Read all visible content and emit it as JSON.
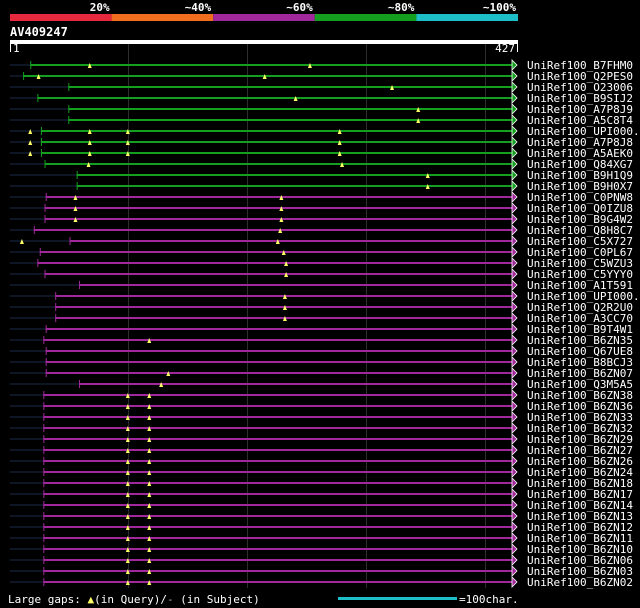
{
  "chart_data": {
    "type": "alignment-overview",
    "query_name": "AV409247",
    "query_start": "1",
    "query_end": "427",
    "query_length": 427,
    "color_legend": [
      {
        "label": "20%",
        "color": "#e8283c"
      },
      {
        "label": "~40%",
        "color": "#f06e1e"
      },
      {
        "label": "~60%",
        "color": "#a0289b"
      },
      {
        "label": "~80%",
        "color": "#14a01e"
      },
      {
        "label": "~100%",
        "color": "#1ebec8"
      }
    ],
    "hits": [
      {
        "name": "UniRef100_B7FHM0",
        "color": "#14a01e",
        "start": 18,
        "end": 427,
        "triangles": [
          68,
          253
        ]
      },
      {
        "name": "UniRef100_Q2PES0",
        "color": "#14a01e",
        "start": 12,
        "end": 427,
        "triangles": [
          25,
          215
        ]
      },
      {
        "name": "UniRef100_O23006",
        "color": "#14a01e",
        "start": 50,
        "end": 427,
        "triangles": [
          322
        ]
      },
      {
        "name": "UniRef100_B9SIJ2",
        "color": "#14a01e",
        "start": 24,
        "end": 427,
        "triangles": [
          241
        ]
      },
      {
        "name": "UniRef100_A7P8J9",
        "color": "#14a01e",
        "start": 50,
        "end": 427,
        "triangles": [
          344
        ]
      },
      {
        "name": "UniRef100_A5C8T4",
        "color": "#14a01e",
        "start": 50,
        "end": 427,
        "triangles": [
          344
        ]
      },
      {
        "name": "UniRef100_UPI000..",
        "color": "#14a01e",
        "start": 27,
        "end": 427,
        "triangles": [
          18,
          68,
          100,
          278
        ]
      },
      {
        "name": "UniRef100_A7P8J8",
        "color": "#14a01e",
        "start": 27,
        "end": 427,
        "triangles": [
          18,
          68,
          100,
          278
        ]
      },
      {
        "name": "UniRef100_A5AEK0",
        "color": "#14a01e",
        "start": 27,
        "end": 427,
        "triangles": [
          18,
          68,
          100,
          278
        ]
      },
      {
        "name": "UniRef100_Q84XG7",
        "color": "#14a01e",
        "start": 30,
        "end": 427,
        "triangles": [
          67,
          280
        ]
      },
      {
        "name": "UniRef100_B9H1Q9",
        "color": "#14a01e",
        "start": 57,
        "end": 427,
        "triangles": [
          352
        ]
      },
      {
        "name": "UniRef100_B9H0X7",
        "color": "#14a01e",
        "start": 57,
        "end": 427,
        "triangles": [
          352
        ]
      },
      {
        "name": "UniRef100_C0PNW8",
        "color": "#a0289b",
        "start": 31,
        "end": 427,
        "triangles": [
          56,
          229
        ]
      },
      {
        "name": "UniRef100_Q0IZU8",
        "color": "#a0289b",
        "start": 30,
        "end": 427,
        "triangles": [
          56,
          229
        ]
      },
      {
        "name": "UniRef100_B9G4W2",
        "color": "#a0289b",
        "start": 30,
        "end": 427,
        "triangles": [
          56,
          229
        ]
      },
      {
        "name": "UniRef100_Q8H8C7",
        "color": "#a0289b",
        "start": 21,
        "end": 427,
        "triangles": [
          228
        ]
      },
      {
        "name": "UniRef100_C5X727",
        "color": "#a0289b",
        "start": 51,
        "end": 427,
        "triangles": [
          11,
          226
        ]
      },
      {
        "name": "UniRef100_C0PL67",
        "color": "#a0289b",
        "start": 26,
        "end": 427,
        "triangles": [
          231
        ]
      },
      {
        "name": "UniRef100_C5WZU3",
        "color": "#a0289b",
        "start": 24,
        "end": 427,
        "triangles": [
          233
        ]
      },
      {
        "name": "UniRef100_C5YYY0",
        "color": "#a0289b",
        "start": 30,
        "end": 427,
        "triangles": [
          233
        ]
      },
      {
        "name": "UniRef100_A1T591",
        "color": "#a0289b",
        "start": 59,
        "end": 427,
        "triangles": []
      },
      {
        "name": "UniRef100_UPI000..",
        "color": "#a0289b",
        "start": 39,
        "end": 427,
        "triangles": [
          232
        ]
      },
      {
        "name": "UniRef100_Q2R2U0",
        "color": "#a0289b",
        "start": 39,
        "end": 427,
        "triangles": [
          232
        ]
      },
      {
        "name": "UniRef100_A3CC70",
        "color": "#a0289b",
        "start": 39,
        "end": 427,
        "triangles": [
          232
        ]
      },
      {
        "name": "UniRef100_B9T4W1",
        "color": "#a0289b",
        "start": 31,
        "end": 427,
        "triangles": []
      },
      {
        "name": "UniRef100_B6ZN35",
        "color": "#a0289b",
        "start": 29,
        "end": 427,
        "triangles": [
          118
        ]
      },
      {
        "name": "UniRef100_Q67UE8",
        "color": "#a0289b",
        "start": 31,
        "end": 427,
        "triangles": []
      },
      {
        "name": "UniRef100_B8BCJ3",
        "color": "#a0289b",
        "start": 31,
        "end": 427,
        "triangles": []
      },
      {
        "name": "UniRef100_B6ZN07",
        "color": "#a0289b",
        "start": 31,
        "end": 427,
        "triangles": [
          134
        ]
      },
      {
        "name": "UniRef100_Q3M5A5",
        "color": "#a0289b",
        "start": 59,
        "end": 427,
        "triangles": [
          128
        ]
      },
      {
        "name": "UniRef100_B6ZN38",
        "color": "#a0289b",
        "start": 29,
        "end": 427,
        "triangles": [
          100,
          118
        ]
      },
      {
        "name": "UniRef100_B6ZN36",
        "color": "#a0289b",
        "start": 29,
        "end": 427,
        "triangles": [
          100,
          118
        ]
      },
      {
        "name": "UniRef100_B6ZN33",
        "color": "#a0289b",
        "start": 29,
        "end": 427,
        "triangles": [
          100,
          118
        ]
      },
      {
        "name": "UniRef100_B6ZN32",
        "color": "#a0289b",
        "start": 29,
        "end": 427,
        "triangles": [
          100,
          118
        ]
      },
      {
        "name": "UniRef100_B6ZN29",
        "color": "#a0289b",
        "start": 29,
        "end": 427,
        "triangles": [
          100,
          118
        ]
      },
      {
        "name": "UniRef100_B6ZN27",
        "color": "#a0289b",
        "start": 29,
        "end": 427,
        "triangles": [
          100,
          118
        ]
      },
      {
        "name": "UniRef100_B6ZN26",
        "color": "#a0289b",
        "start": 29,
        "end": 427,
        "triangles": [
          100,
          118
        ]
      },
      {
        "name": "UniRef100_B6ZN24",
        "color": "#a0289b",
        "start": 29,
        "end": 427,
        "triangles": [
          100,
          118
        ]
      },
      {
        "name": "UniRef100_B6ZN18",
        "color": "#a0289b",
        "start": 29,
        "end": 427,
        "triangles": [
          100,
          118
        ]
      },
      {
        "name": "UniRef100_B6ZN17",
        "color": "#a0289b",
        "start": 29,
        "end": 427,
        "triangles": [
          100,
          118
        ]
      },
      {
        "name": "UniRef100_B6ZN14",
        "color": "#a0289b",
        "start": 29,
        "end": 427,
        "triangles": [
          100,
          118
        ]
      },
      {
        "name": "UniRef100_B6ZN13",
        "color": "#a0289b",
        "start": 29,
        "end": 427,
        "triangles": [
          100,
          118
        ]
      },
      {
        "name": "UniRef100_B6ZN12",
        "color": "#a0289b",
        "start": 29,
        "end": 427,
        "triangles": [
          100,
          118
        ]
      },
      {
        "name": "UniRef100_B6ZN11",
        "color": "#a0289b",
        "start": 29,
        "end": 427,
        "triangles": [
          100,
          118
        ]
      },
      {
        "name": "UniRef100_B6ZN10",
        "color": "#a0289b",
        "start": 29,
        "end": 427,
        "triangles": [
          100,
          118
        ]
      },
      {
        "name": "UniRef100_B6ZN06",
        "color": "#a0289b",
        "start": 29,
        "end": 427,
        "triangles": [
          100,
          118
        ]
      },
      {
        "name": "UniRef100_B6ZN03",
        "color": "#a0289b",
        "start": 29,
        "end": 427,
        "triangles": [
          100,
          118
        ]
      },
      {
        "name": "UniRef100_B6ZN02",
        "color": "#a0289b",
        "start": 29,
        "end": 427,
        "triangles": [
          100,
          118
        ]
      }
    ],
    "footer": {
      "gaps_prefix": "Large gaps: ",
      "gaps_query": "(in Query)/",
      "gaps_subject_marker": "-",
      "gaps_subject": " (in Subject)",
      "scale_label": "=100char.",
      "scale_color": "#1ebec8"
    }
  }
}
